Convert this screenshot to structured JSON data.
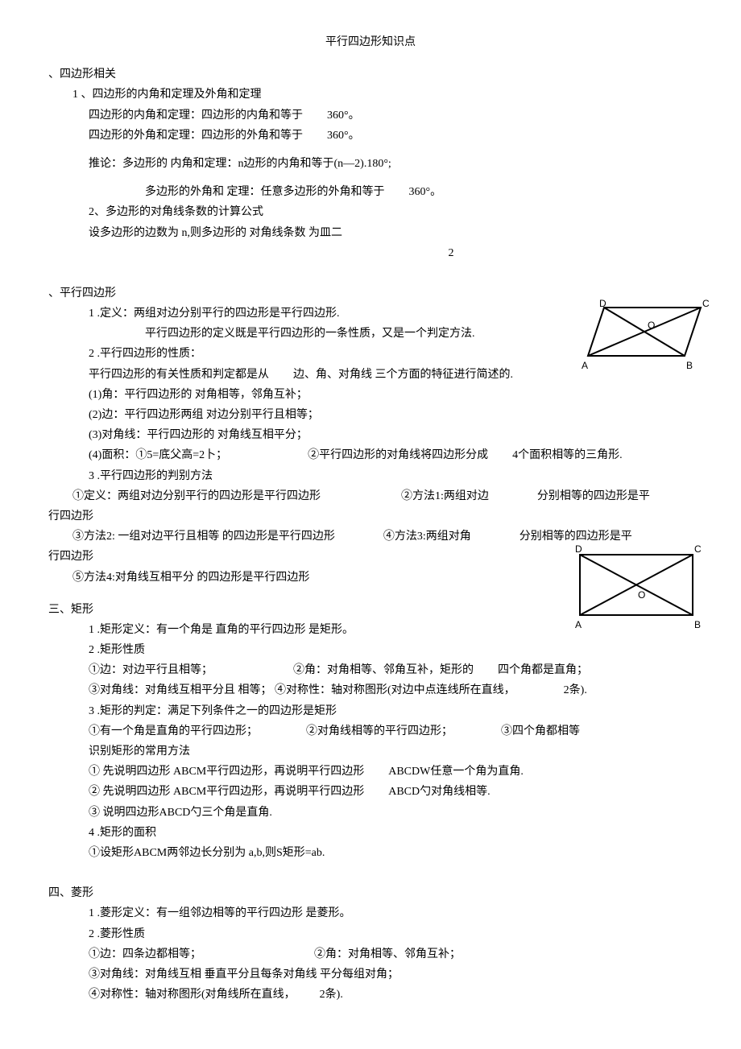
{
  "title": "平行四边形知识点",
  "s1": {
    "heading": "、四边形相关",
    "item1_title": "1 、四边形的内角和定理及外角和定理",
    "item1_l1": "四边形的内角和定理：四边形的内角和等于",
    "item1_l1_val": "360°。",
    "item1_l2": "四边形的外角和定理：四边形的外角和等于",
    "item1_l2_val": "360°。",
    "item1_l3": "推论：多边形的 内角和定理：n边形的内角和等于(n—2).180°;",
    "item1_l4": "多边形的外角和  定理：任意多边形的外角和等于",
    "item1_l4_val": "360°。",
    "item2_title": "2、多边形的对角线条数的计算公式",
    "item2_l1": "设多边形的边数为 n,则多边形的 对角线条数 为皿二",
    "item2_frac": "2"
  },
  "s2": {
    "heading": "、平行四边形",
    "l1": "1 .定义：两组对边分别平行的四边形是平行四边形.",
    "l1b": "平行四边形的定义既是平行四边形的一条性质，又是一个判定方法.",
    "l2": "2 .平行四边形的性质：",
    "l3": "平行四边形的有关性质和判定都是从",
    "l3b": "边、角、对角线 三个方面的特征进行简述的.",
    "l4": "(1)角：平行四边形的 对角相等，邻角互补；",
    "l5": "(2)边：平行四边形两组 对边分别平行且相等；",
    "l6": "(3)对角线：平行四边形的 对角线互相平分；",
    "l7a": "(4)面积：①5=底父高=2卜；",
    "l7b": "②平行四边形的对角线将四边形分成",
    "l7c": "4个面积相等的三角形.",
    "l8": "3 .平行四边形的判别方法",
    "l9a": "①定义：两组对边分别平行的四边形是平行四边形",
    "l9b": "②方法1:两组对边",
    "l9c": "分别相等的四边形是平",
    "l10": "行四边形",
    "l11a": "③方法2: 一组对边平行且相等 的四边形是平行四边形",
    "l11b": "④方法3:两组对角",
    "l11c": "分别相等的四边形是平",
    "l12": "行四边形",
    "l13": "⑤方法4:对角线互相平分 的四边形是平行四边形",
    "fig1_D": "D",
    "fig1_C": "C",
    "fig1_A": "A",
    "fig1_B": "B",
    "fig1_O": "O"
  },
  "s3": {
    "heading": "三、矩形",
    "l1": "1 .矩形定义：有一个角是 直角的平行四边形 是矩形。",
    "l2": "2 .矩形性质",
    "l3a": "①边：对边平行且相等；",
    "l3b": "②角：对角相等、邻角互补，矩形的",
    "l3c": "四个角都是直角；",
    "l4a": "③对角线：对角线互相平分且 相等；  ④对称性：轴对称图形(对边中点连线所在直线，",
    "l4b": "2条).",
    "l5": "3 .矩形的判定：满足下列条件之一的四边形是矩形",
    "l6a": "①有一个角是直角的平行四边形；",
    "l6b": "②对角线相等的平行四边形；",
    "l6c": "③四个角都相等",
    "l7": "识别矩形的常用方法",
    "l8a": "① 先说明四边形 ABCM平行四边形，再说明平行四边形",
    "l8b": "ABCDW任意一个角为直角.",
    "l9a": "② 先说明四边形 ABCM平行四边形，再说明平行四边形",
    "l9b": "ABCD勺对角线相等.",
    "l10": "③ 说明四边形ABCD勺三个角是直角.",
    "l11": "4 .矩形的面积",
    "l12": "①设矩形ABCM两邻边长分别为 a,b,则S矩形=ab.",
    "fig2_D": "D",
    "fig2_C": "C",
    "fig2_A": "A",
    "fig2_B": "B",
    "fig2_O": "O"
  },
  "s4": {
    "heading": "四、菱形",
    "l1": "1 .菱形定义：有一组邻边相等的平行四边形 是菱形。",
    "l2": "2 .菱形性质",
    "l3a": "①边：四条边都相等；",
    "l3b": "②角：对角相等、邻角互补；",
    "l4": "③对角线：对角线互相  垂直平分且每条对角线 平分每组对角；",
    "l5a": "④对称性：轴对称图形(对角线所在直线，",
    "l5b": "2条)."
  }
}
